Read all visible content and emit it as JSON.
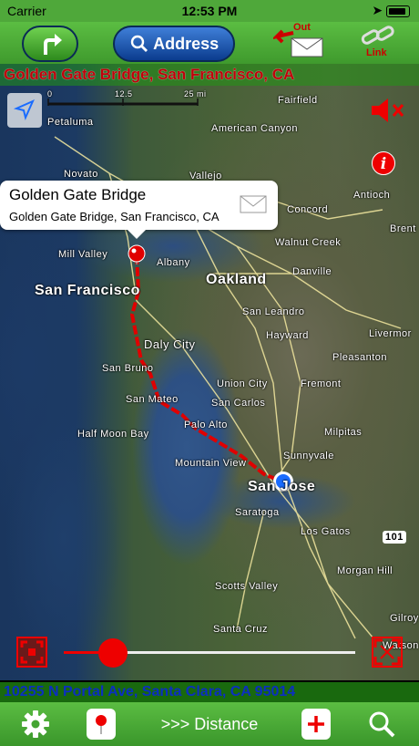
{
  "status_bar": {
    "carrier": "Carrier",
    "time": "12:53 PM"
  },
  "toolbar": {
    "address_label": "Address",
    "out_label": "Out",
    "link_label": "Link"
  },
  "map": {
    "destination_banner": "Golden Gate Bridge, San Francisco, CA",
    "current_address": "10255 N Portal Ave, Santa Clara, CA 95014",
    "scale_ticks": [
      "0",
      "12.5",
      "25 mi"
    ],
    "callout": {
      "title": "Golden Gate Bridge",
      "subtitle": "Golden Gate Bridge, San Francisco, CA"
    },
    "places": {
      "petaluma": "Petaluma",
      "fairfield": "Fairfield",
      "american_canyon": "American Canyon",
      "novato": "Novato",
      "vallejo": "Vallejo",
      "antioch": "Antioch",
      "concord": "Concord",
      "brentwood": "Brent",
      "mill_valley": "Mill Valley",
      "walnut_creek": "Walnut Creek",
      "albany": "Albany",
      "oakland": "Oakland",
      "danville": "Danville",
      "san_francisco": "San Francisco",
      "san_leandro": "San Leandro",
      "livermore": "Livermor",
      "daly_city": "Daly City",
      "hayward": "Hayward",
      "pleasanton": "Pleasanton",
      "san_bruno": "San Bruno",
      "union_city": "Union City",
      "fremont": "Fremont",
      "san_mateo": "San Mateo",
      "san_carlos": "San Carlos",
      "half_moon_bay": "Half Moon Bay",
      "palo_alto": "Palo Alto",
      "milpitas": "Milpitas",
      "sunnyvale": "Sunnyvale",
      "mountain_view": "Mountain View",
      "san_jose": "San Jose",
      "saratoga": "Saratoga",
      "los_gatos": "Los Gatos",
      "morgan_hill": "Morgan Hill",
      "scotts_valley": "Scotts Valley",
      "santa_cruz": "Santa Cruz",
      "gilroy": "Gilroy",
      "watsonville": "Watson",
      "highway_101": "101"
    }
  },
  "bottom_bar": {
    "distance_label": ">>> Distance"
  },
  "icons": {
    "turn": "turn-right-arrow-icon",
    "search": "magnifier-icon",
    "out": "envelope-out-icon",
    "link": "chain-link-icon",
    "locate": "location-arrow-icon",
    "mute": "speaker-muted-icon",
    "info": "info-icon",
    "settings": "gear-icon",
    "pin": "map-pin-icon",
    "plus": "plus-icon"
  },
  "colors": {
    "toolbar_green": "#4fa83a",
    "route_red": "#e00000",
    "address_blue": "#0b3c8e"
  },
  "slider": {
    "position_fraction": 0.15
  }
}
